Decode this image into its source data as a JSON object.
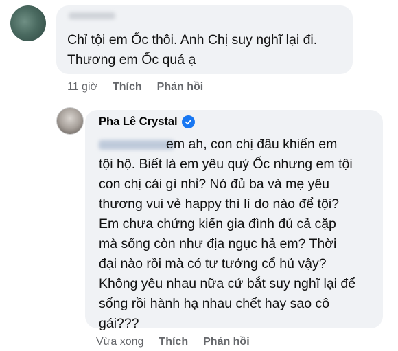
{
  "comments": [
    {
      "text": "Chỉ tội em Ốc thôi. Anh Chị suy nghĩ lại đi.\nThương em Ốc quá ạ",
      "time": "11 giờ",
      "like_label": "Thích",
      "reply_label": "Phản hồi"
    },
    {
      "author": "Pha Lê Crystal",
      "verified_icon": "verified-badge-icon",
      "lines": [
        "em ah, con chị đâu khiến em",
        "tội hộ. Biết là em yêu quý Ốc nhưng em tội",
        "con chị cái gì nhỉ? Nó đủ ba và mẹ yêu",
        "thương vui vẻ happy thì lí do nào để tội?",
        "Em chưa chứng kiến gia đình đủ cả cặp",
        "mà sống còn như địa ngục hả em? Thời",
        "đại nào rồi mà có tư tưởng cổ hủ vậy?",
        "Không yêu nhau nữa cứ bắt suy nghĩ lại để",
        "sống rồi hành hạ nhau chết hay sao cô",
        "gái???"
      ],
      "time": "Vừa xong",
      "like_label": "Thích",
      "reply_label": "Phản hồi"
    }
  ],
  "colors": {
    "bubble": "#f0f2f5",
    "meta_text": "#65676b",
    "verified": "#1877f2"
  }
}
